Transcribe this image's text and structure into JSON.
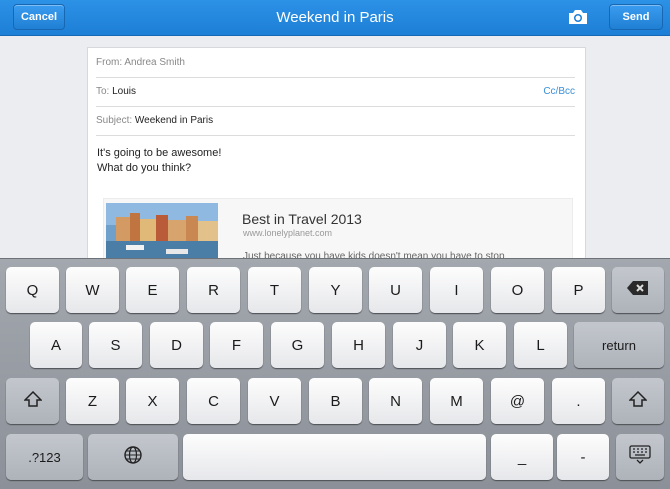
{
  "topbar": {
    "title": "Weekend in Paris",
    "cancel_label": "Cancel",
    "send_label": "Send",
    "camera_icon": "camera-icon"
  },
  "compose": {
    "from_label": "From:",
    "from_value": "Andrea Smith",
    "to_label": "To:",
    "to_value": "Louis",
    "cc_label": "Cc/Bcc",
    "subject_label": "Subject:",
    "subject_value": "Weekend in Paris",
    "body_lines": [
      "It's going to be awesome!",
      "What do you think?"
    ],
    "link_card": {
      "title": "Best in Travel 2013",
      "url": "www.lonelyplanet.com",
      "description": "Just because you have kids doesn't mean you have to stop"
    }
  },
  "keyboard": {
    "row1": [
      "Q",
      "W",
      "E",
      "R",
      "T",
      "Y",
      "U",
      "I",
      "O",
      "P"
    ],
    "row2": [
      "A",
      "S",
      "D",
      "F",
      "G",
      "H",
      "J",
      "K",
      "L"
    ],
    "row3": [
      "Z",
      "X",
      "C",
      "V",
      "B",
      "N",
      "M",
      "@",
      "."
    ],
    "return_label": "return",
    "numbers_label": ".?123",
    "underscore_label": "_",
    "dash_label": "-",
    "icons": [
      "backspace-icon",
      "shift-icon",
      "globe-icon",
      "keyboard-hide-icon"
    ]
  }
}
